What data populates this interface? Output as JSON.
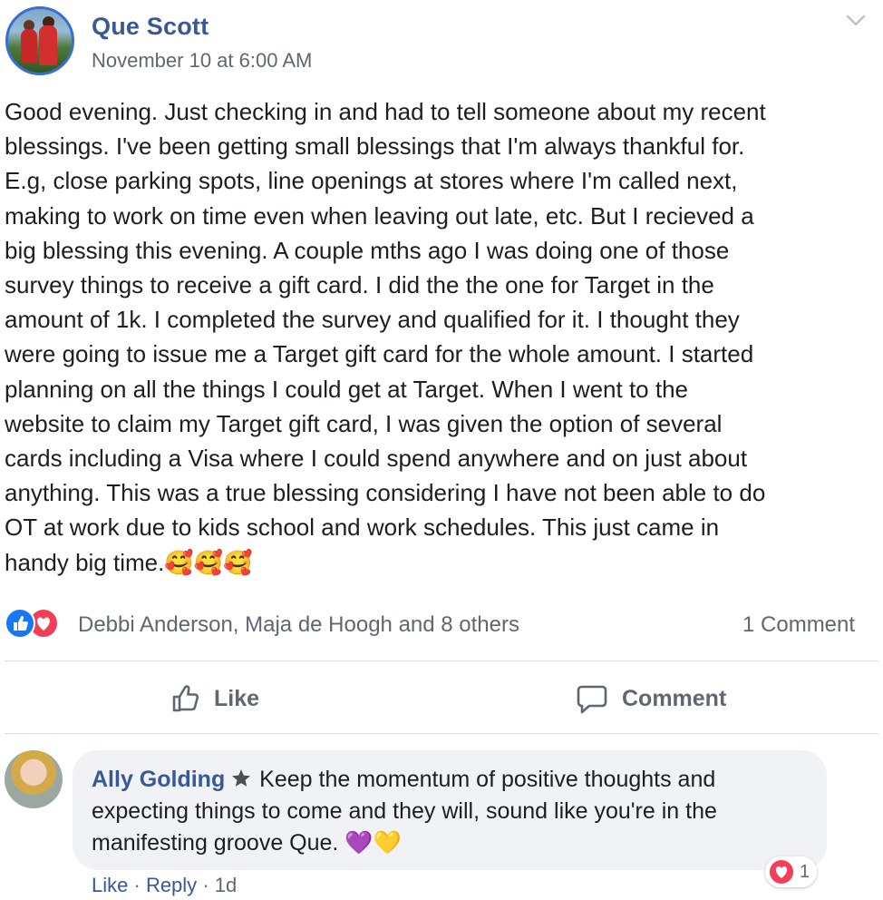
{
  "post": {
    "author": "Que Scott",
    "date": "November 10 at 6:00 AM",
    "text": "Good evening. Just checking in and had to tell someone about my recent\nblessings. I've been getting small blessings that I'm always thankful for.\nE.g, close parking spots, line openings at stores where I'm called next,\nmaking to work on time even when leaving out late, etc. But I recieved a\nbig blessing this evening. A couple mths ago I was doing one of those\nsurvey things to receive a gift card. I did the the one for Target in the\namount of 1k. I completed the survey and qualified for it. I thought they\nwere going to issue me a Target gift card for the whole amount. I started\nplanning on all the things I could get at Target. When I went to the\nwebsite to claim my Target gift card, I was given the option of several\ncards including a Visa where I could spend anywhere and on just about\nanything. This was a true blessing considering I have not been able to do\nOT at work due to kids school and work schedules. This just came in\nhandy big time.🥰🥰🥰"
  },
  "reactions": {
    "icons": [
      "like-icon",
      "love-icon"
    ],
    "summary": "Debbi Anderson, Maja de Hoogh and 8 others",
    "comment_count": "1 Comment"
  },
  "actions": {
    "like_label": "Like",
    "comment_label": "Comment"
  },
  "comment": {
    "name": "Ally Golding",
    "badge_icon": "top-fan-star-icon",
    "text": " Keep the momentum of positive thoughts and expecting things to come and they will, sound like you're in the manifesting groove Que. 💜💛",
    "reaction_count": "1",
    "like_label": "Like",
    "reply_label": "Reply",
    "separator": "·",
    "time": "1d"
  },
  "colors": {
    "link_blue": "#385898",
    "like_blue": "#1877f2",
    "love_red": "#f33e58",
    "muted_gray": "#606770",
    "bubble_bg": "#f0f2f5"
  }
}
